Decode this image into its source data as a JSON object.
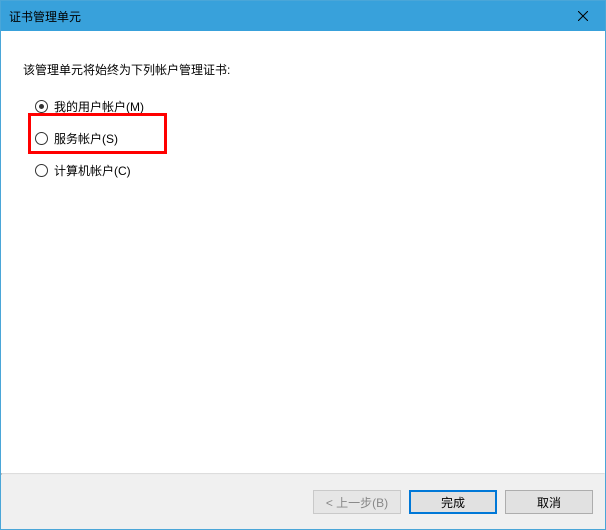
{
  "window": {
    "title": "证书管理单元"
  },
  "body": {
    "prompt": "该管理单元将始终为下列帐户管理证书:",
    "options": [
      {
        "label": "我的用户帐户(M)",
        "checked": true
      },
      {
        "label": "服务帐户(S)",
        "checked": false
      },
      {
        "label": "计算机帐户(C)",
        "checked": false
      }
    ]
  },
  "footer": {
    "back": "< 上一步(B)",
    "finish": "完成",
    "cancel": "取消"
  }
}
